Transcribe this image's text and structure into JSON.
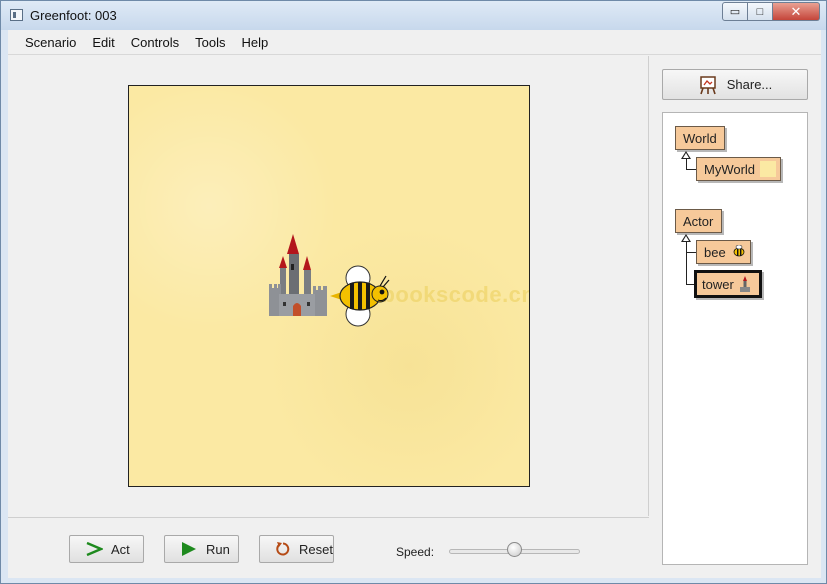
{
  "window": {
    "title": "Greenfoot: 003",
    "minimize_glyph": "▭",
    "maximize_glyph": "□",
    "close_glyph": "✕"
  },
  "menu": {
    "items": [
      "Scenario",
      "Edit",
      "Controls",
      "Tools",
      "Help"
    ]
  },
  "world": {
    "watermark": "itbookscode.cn",
    "background_color": "#fbe9a3",
    "actors": [
      {
        "name": "tower",
        "icon": "castle-tower"
      },
      {
        "name": "bee",
        "icon": "bee"
      }
    ]
  },
  "controls": {
    "act_label": "Act",
    "run_label": "Run",
    "reset_label": "Reset",
    "speed_label": "Speed:",
    "speed_value": 0.5
  },
  "side": {
    "share_label": "Share...",
    "classes": {
      "world_root": "World",
      "world_sub": "MyWorld",
      "actor_root": "Actor",
      "actor_sub_1": "bee",
      "actor_sub_2": "tower"
    },
    "class_color": "#f6c99a",
    "selected_class": "tower"
  }
}
